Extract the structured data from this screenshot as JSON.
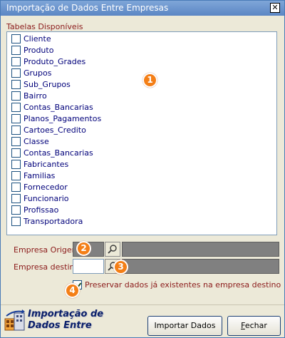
{
  "window": {
    "title": "Importação de Dados Entre Empresas",
    "close_icon": "close-icon"
  },
  "tables": {
    "label": "Tabelas Disponíveis",
    "items": [
      {
        "label": "Cliente",
        "checked": false
      },
      {
        "label": "Produto",
        "checked": false
      },
      {
        "label": "Produto_Grades",
        "checked": false
      },
      {
        "label": "Grupos",
        "checked": false
      },
      {
        "label": "Sub_Grupos",
        "checked": false
      },
      {
        "label": "Bairro",
        "checked": false
      },
      {
        "label": "Contas_Bancarias",
        "checked": false
      },
      {
        "label": "Planos_Pagamentos",
        "checked": false
      },
      {
        "label": "Cartoes_Credito",
        "checked": false
      },
      {
        "label": "Classe",
        "checked": false
      },
      {
        "label": "Contas_Bancarias",
        "checked": false
      },
      {
        "label": "Fabricantes",
        "checked": false
      },
      {
        "label": "Familias",
        "checked": false
      },
      {
        "label": "Fornecedor",
        "checked": false
      },
      {
        "label": "Funcionario",
        "checked": false
      },
      {
        "label": "Profissao",
        "checked": false
      },
      {
        "label": "Transportadora",
        "checked": false
      }
    ]
  },
  "form": {
    "origem_label": "Empresa Origem",
    "origem_code": "",
    "origem_name": "",
    "destino_label": "Empresa destino",
    "destino_code": "",
    "destino_name": "",
    "preserve_label": "Preservar dados já existentes na empresa destino",
    "preserve_checked": true
  },
  "badges": [
    "1",
    "2",
    "3",
    "4"
  ],
  "footer": {
    "logo_line1": "Importação de",
    "logo_line2": "Dados Entre",
    "import_button": "Importar Dados",
    "close_button": "Fechar"
  },
  "colors": {
    "badge": "#f47f17",
    "label_red": "#8b1a1a",
    "item_blue": "#00007a",
    "titlebar": "#6b94ce"
  }
}
